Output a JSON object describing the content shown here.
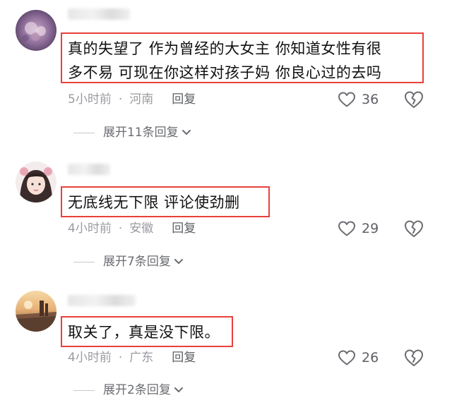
{
  "comments": [
    {
      "text": "真的失望了 作为曾经的大女主 你知道女性有很\n多不易 可现在你这样对孩子妈 你良心过的去吗",
      "time": "5小时前",
      "location": "河南",
      "reply_label": "回复",
      "likes": "36",
      "expand_label": "展开11条回复"
    },
    {
      "text": "无底线无下限 评论使劲删",
      "time": "4小时前",
      "location": "安徽",
      "reply_label": "回复",
      "likes": "29",
      "expand_label": "展开7条回复"
    },
    {
      "text": "取关了，真是没下限。",
      "time": "4小时前",
      "location": "广东",
      "reply_label": "回复",
      "likes": "26",
      "expand_label": "展开2条回复"
    }
  ],
  "colors": {
    "highlight_border": "#e8403a",
    "meta_text": "#9a9ba0",
    "body_text": "#111111"
  }
}
